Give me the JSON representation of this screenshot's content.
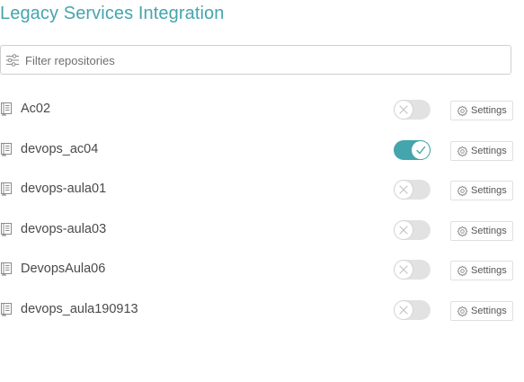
{
  "header": {
    "title": "Legacy Services Integration"
  },
  "filter": {
    "placeholder": "Filter repositories",
    "value": "",
    "icon": "filter-sliders-icon"
  },
  "repositories": [
    {
      "name": "Ac02",
      "enabled": false,
      "settings_label": "Settings"
    },
    {
      "name": "devops_ac04",
      "enabled": true,
      "settings_label": "Settings"
    },
    {
      "name": "devops-aula01",
      "enabled": false,
      "settings_label": "Settings"
    },
    {
      "name": "devops-aula03",
      "enabled": false,
      "settings_label": "Settings"
    },
    {
      "name": "DevopsAula06",
      "enabled": false,
      "settings_label": "Settings"
    },
    {
      "name": "devops_aula190913",
      "enabled": false,
      "settings_label": "Settings"
    }
  ],
  "colors": {
    "accent": "#45a5ad",
    "toggle_off": "#e2e2e2",
    "text": "#4a4a4a"
  }
}
